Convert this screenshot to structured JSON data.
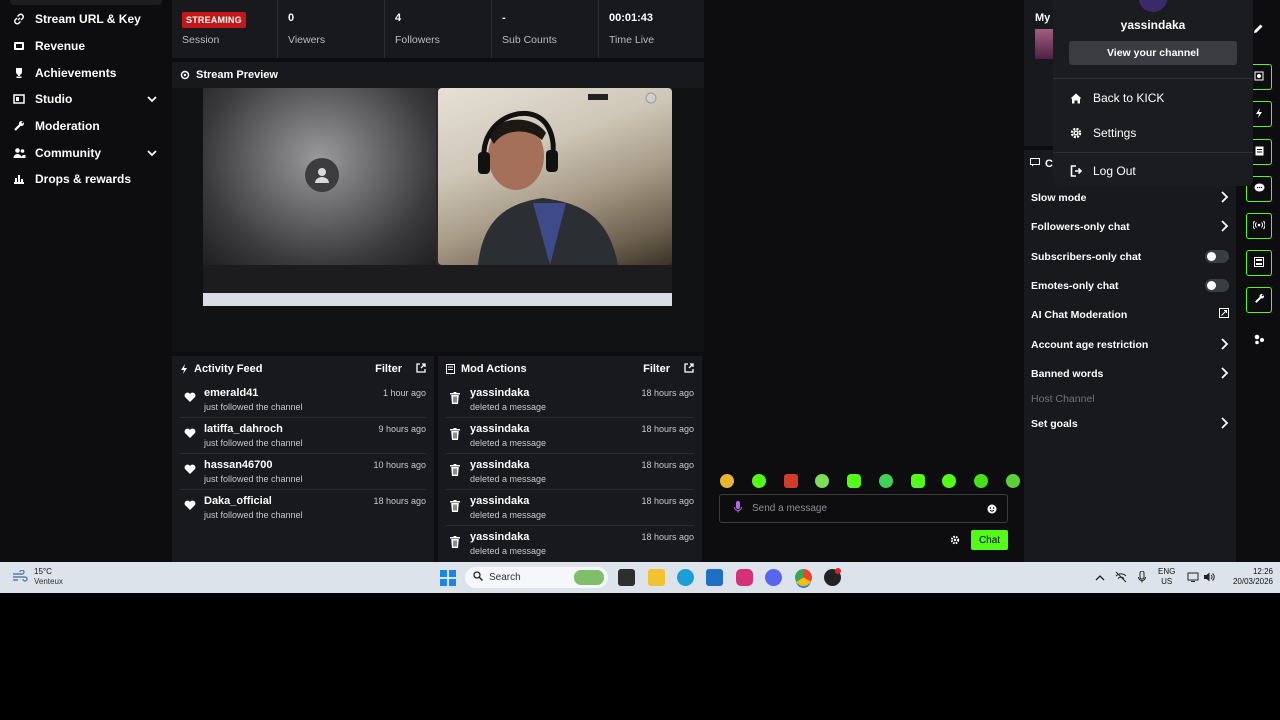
{
  "sidebar": {
    "items": [
      {
        "label": "Stream URL & Key",
        "icon": "link-icon"
      },
      {
        "label": "Revenue",
        "icon": "dollar-icon"
      },
      {
        "label": "Achievements",
        "icon": "trophy-icon"
      },
      {
        "label": "Studio",
        "icon": "studio-icon",
        "expandable": true
      },
      {
        "label": "Moderation",
        "icon": "wrench-icon"
      },
      {
        "label": "Community",
        "icon": "community-icon",
        "expandable": true
      },
      {
        "label": "Drops & rewards",
        "icon": "drops-icon"
      }
    ]
  },
  "stats": {
    "status_badge": "STREAMING",
    "session_label": "Session",
    "viewers": {
      "value": "0",
      "label": "Viewers"
    },
    "followers": {
      "value": "4",
      "label": "Followers"
    },
    "subs": {
      "value": "-",
      "label": "Sub Counts"
    },
    "time": {
      "value": "00:01:43",
      "label": "Time Live"
    }
  },
  "preview": {
    "title": "Stream Preview"
  },
  "activity": {
    "title": "Activity Feed",
    "filter": "Filter",
    "items": [
      {
        "name": "emerald41",
        "action": "just followed the channel",
        "time": "1 hour ago"
      },
      {
        "name": "latiffa_dahroch",
        "action": "just followed the channel",
        "time": "9 hours ago"
      },
      {
        "name": "hassan46700",
        "action": "just followed the channel",
        "time": "10 hours ago"
      },
      {
        "name": "Daka_official",
        "action": "just followed the channel",
        "time": "18 hours ago"
      }
    ]
  },
  "mod": {
    "title": "Mod Actions",
    "filter": "Filter",
    "items": [
      {
        "name": "yassindaka",
        "action": "deleted a message",
        "time": "18 hours ago"
      },
      {
        "name": "yassindaka",
        "action": "deleted a message",
        "time": "18 hours ago"
      },
      {
        "name": "yassindaka",
        "action": "deleted a message",
        "time": "18 hours ago"
      },
      {
        "name": "yassindaka",
        "action": "deleted a message",
        "time": "18 hours ago"
      },
      {
        "name": "yassindaka",
        "action": "deleted a message",
        "time": "18 hours ago"
      }
    ]
  },
  "chat": {
    "placeholder": "Send a message",
    "send_label": "Chat"
  },
  "right_panel": {
    "top_title": "My f",
    "bottom_title": "Cl",
    "settings": [
      {
        "label": "Slow mode",
        "control": "chevron"
      },
      {
        "label": "Followers-only chat",
        "control": "chevron"
      },
      {
        "label": "Subscribers-only chat",
        "control": "toggle"
      },
      {
        "label": "Emotes-only chat",
        "control": "toggle"
      },
      {
        "label": "AI Chat Moderation",
        "control": "external"
      },
      {
        "label": "Account age restriction",
        "control": "chevron"
      },
      {
        "label": "Banned words",
        "control": "chevron"
      },
      {
        "label": "Host Channel",
        "control": "none",
        "disabled": true
      },
      {
        "label": "Set goals",
        "control": "chevron"
      }
    ]
  },
  "dropdown": {
    "username": "yassindaka",
    "view_channel": "View your channel",
    "items": [
      {
        "label": "Back to KICK",
        "icon": "home-icon"
      },
      {
        "label": "Settings",
        "icon": "gear-icon"
      },
      {
        "label": "Log Out",
        "icon": "logout-icon"
      }
    ]
  },
  "taskbar": {
    "temp": "15°C",
    "weather": "Venteux",
    "search": "Search",
    "lang1": "ENG",
    "lang2": "US",
    "time": "12:26",
    "date": "20/03/2026"
  },
  "colors": {
    "accent": "#53fc18",
    "streaming": "#c41818",
    "panel": "#18191c",
    "background": "#0d0d0f"
  }
}
